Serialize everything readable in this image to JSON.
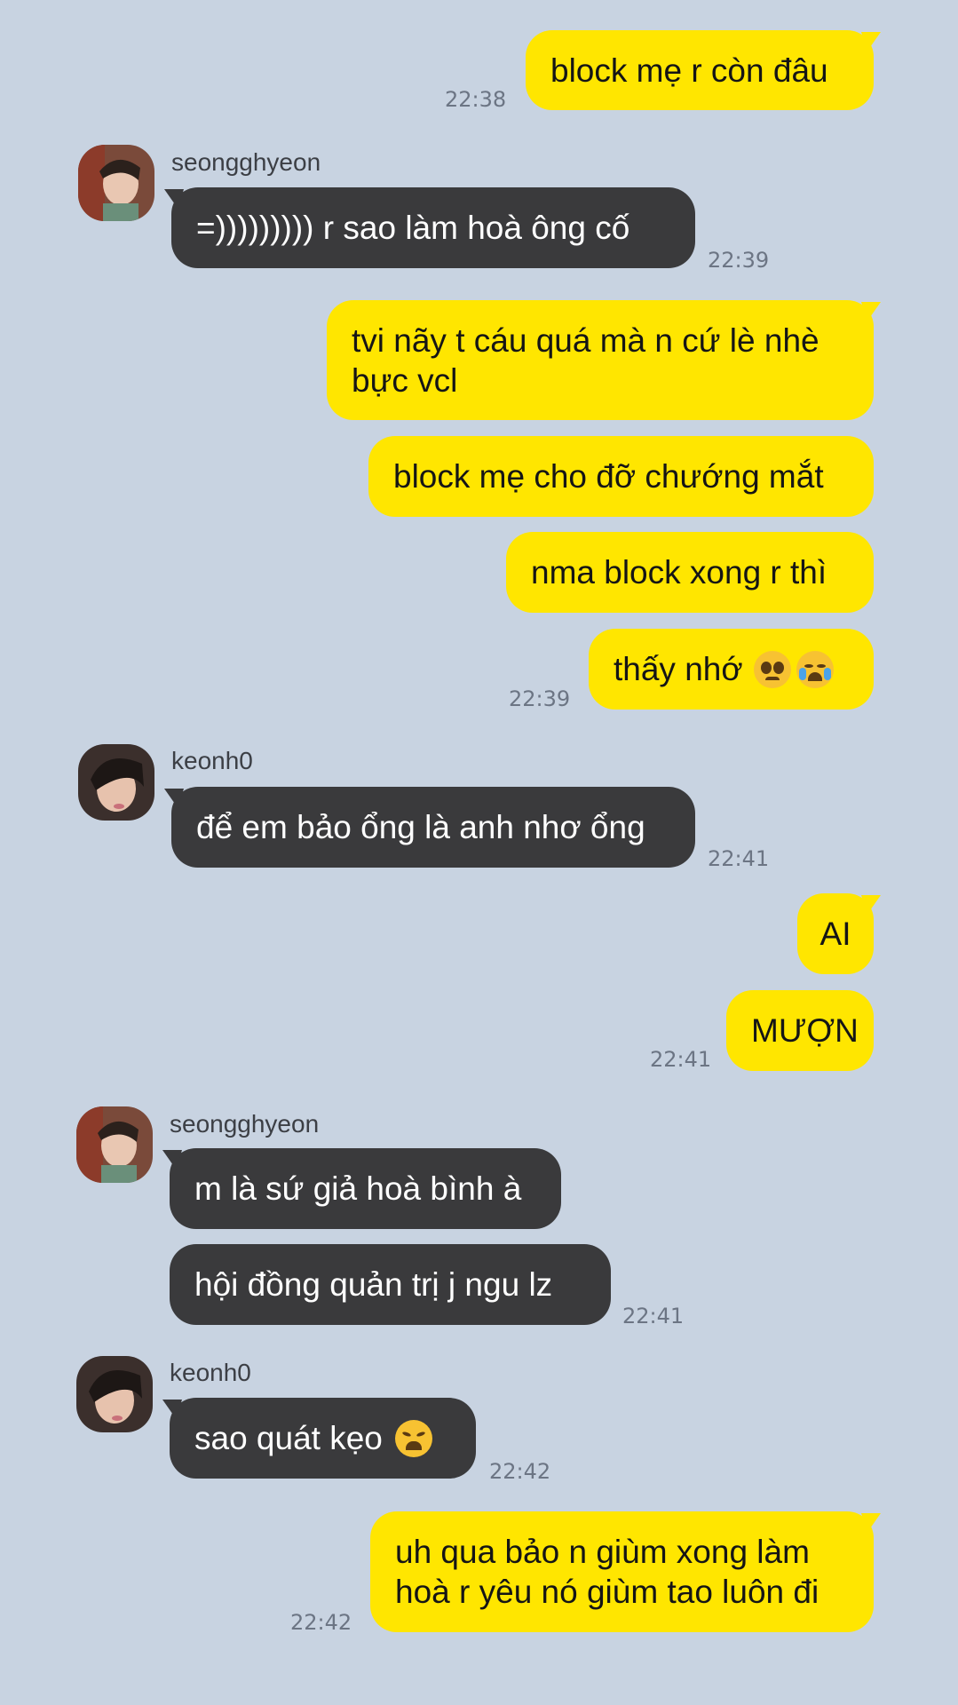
{
  "colors": {
    "background": "#c8d3e1",
    "outgoing_bubble": "#ffe600",
    "incoming_bubble": "#3a3a3c",
    "timestamp": "#6c7584"
  },
  "contacts": {
    "seongghyeon": "seongghyeon",
    "keonh0": "keonh0"
  },
  "messages": {
    "m1": {
      "text": "block mẹ r còn đâu",
      "time": "22:38"
    },
    "m2": {
      "sender": "seongghyeon",
      "text": "=))))))))) r sao làm hoà ông cố",
      "time": "22:39"
    },
    "m3": {
      "text": "tvi nãy t cáu quá mà n cứ lè nhè bực vcl"
    },
    "m4": {
      "text": "block mẹ cho đỡ chướng mắt"
    },
    "m5": {
      "text": "nma block xong r thì"
    },
    "m6": {
      "text": "thấy nhớ",
      "emojis": [
        "pleading-face",
        "loudly-crying-face"
      ],
      "time": "22:39"
    },
    "m7": {
      "sender": "keonh0",
      "text": "để em bảo ổng là anh nhơ ổng",
      "time": "22:41"
    },
    "m8": {
      "text": "AI"
    },
    "m9": {
      "text": "MƯỢN",
      "time": "22:41"
    },
    "m10": {
      "sender": "seongghyeon",
      "text": "m là sứ giả hoà bình à"
    },
    "m11": {
      "text": "hội đồng quản trị j ngu lz",
      "time": "22:41"
    },
    "m12": {
      "sender": "keonh0",
      "text": "sao quát kẹo",
      "emoji": "weary-face",
      "time": "22:42"
    },
    "m13": {
      "text": "uh qua bảo n giùm xong làm hoà r yêu nó giùm tao luôn đi",
      "time": "22:42"
    }
  }
}
